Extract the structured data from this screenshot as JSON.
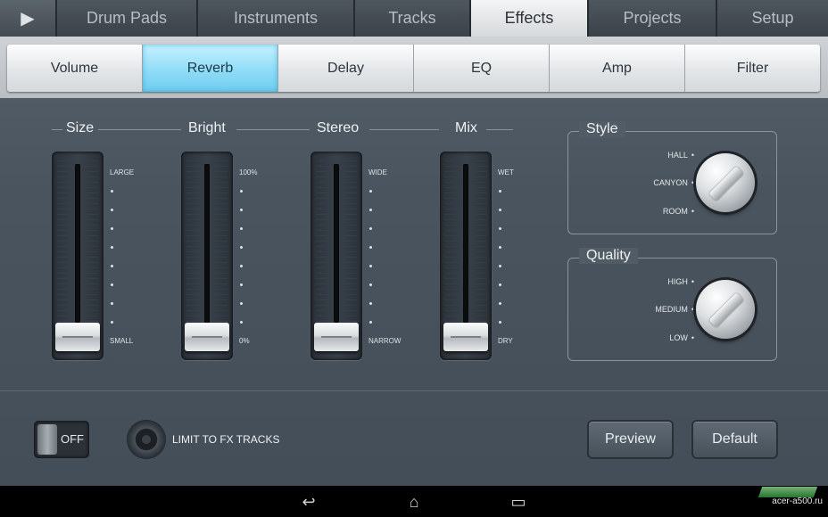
{
  "top_tabs": {
    "play_icon": "▶",
    "items": [
      "Drum Pads",
      "Instruments",
      "Tracks",
      "Effects",
      "Projects",
      "Setup"
    ],
    "active": "Effects"
  },
  "sub_tabs": {
    "items": [
      "Volume",
      "Reverb",
      "Delay",
      "EQ",
      "Amp",
      "Filter"
    ],
    "active": "Reverb"
  },
  "sliders": [
    {
      "title": "Size",
      "top_label": "LARGE",
      "bottom_label": "SMALL",
      "value": 0
    },
    {
      "title": "Bright",
      "top_label": "100%",
      "bottom_label": "0%",
      "value": 0
    },
    {
      "title": "Stereo",
      "top_label": "WIDE",
      "bottom_label": "NARROW",
      "value": 0
    },
    {
      "title": "Mix",
      "top_label": "WET",
      "bottom_label": "DRY",
      "value": 0
    }
  ],
  "style_panel": {
    "title": "Style",
    "options": [
      "HALL",
      "CANYON",
      "ROOM"
    ]
  },
  "quality_panel": {
    "title": "Quality",
    "options": [
      "HIGH",
      "MEDIUM",
      "LOW"
    ]
  },
  "toggle": {
    "label": "OFF",
    "state": "off"
  },
  "limit_option": {
    "label": "LIMIT TO FX TRACKS"
  },
  "buttons": {
    "preview": "Preview",
    "default": "Default"
  },
  "nav": {
    "back": "↩",
    "home": "⌂",
    "recents": "▭"
  },
  "watermark": "acer-a500.ru"
}
